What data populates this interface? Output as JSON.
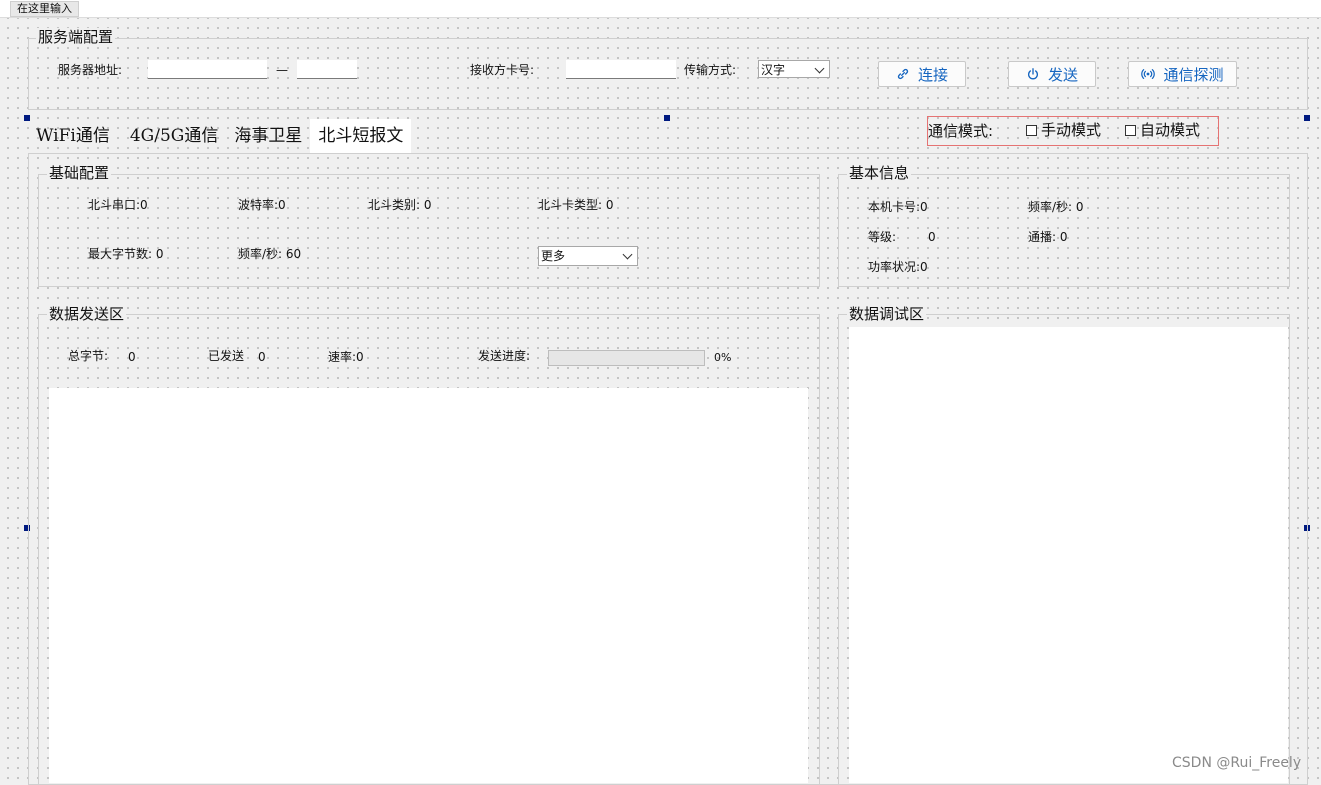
{
  "menu": {
    "entry": "在这里输入"
  },
  "server": {
    "title": "服务端配置",
    "address_label": "服务器地址:",
    "dash": "—",
    "receiver_label": "接收方卡号:",
    "transfer_label": "传输方式:",
    "transfer_value": "汉字",
    "connect": "连接",
    "send": "发送",
    "probe": "通信探测"
  },
  "tabs": [
    "WiFi通信",
    "4G/5G通信",
    "海事卫星",
    "北斗短报文"
  ],
  "active_tab": 3,
  "mode": {
    "label": "通信模式:",
    "manual": "手动模式",
    "auto": "自动模式"
  },
  "basic_config": {
    "title": "基础配置",
    "serial": "北斗串口:0",
    "baud": "波特率:0",
    "category": "北斗类别: 0",
    "card_type": "北斗卡类型: 0",
    "max_bytes": "最大字节数: 0",
    "freq": "频率/秒: 60",
    "more": "更多"
  },
  "basic_info": {
    "title": "基本信息",
    "card_no": "本机卡号:0",
    "freq": "频率/秒: 0",
    "level": "等级:",
    "level_value": "0",
    "broadcast": "通播: 0",
    "power": "功率状况:0"
  },
  "send_area": {
    "title": "数据发送区",
    "total": "总字节:",
    "total_value": "0",
    "sent": "已发送",
    "sent_value": "0",
    "rate": "速率:0",
    "progress_label": "发送进度:",
    "progress": 0,
    "progress_text": "0%"
  },
  "debug_area": {
    "title": "数据调试区"
  },
  "watermark": "CSDN @Rui_Freely",
  "colors": {
    "accent": "#1565c0",
    "mode_border": "#e57373",
    "handle": "#001a80"
  }
}
